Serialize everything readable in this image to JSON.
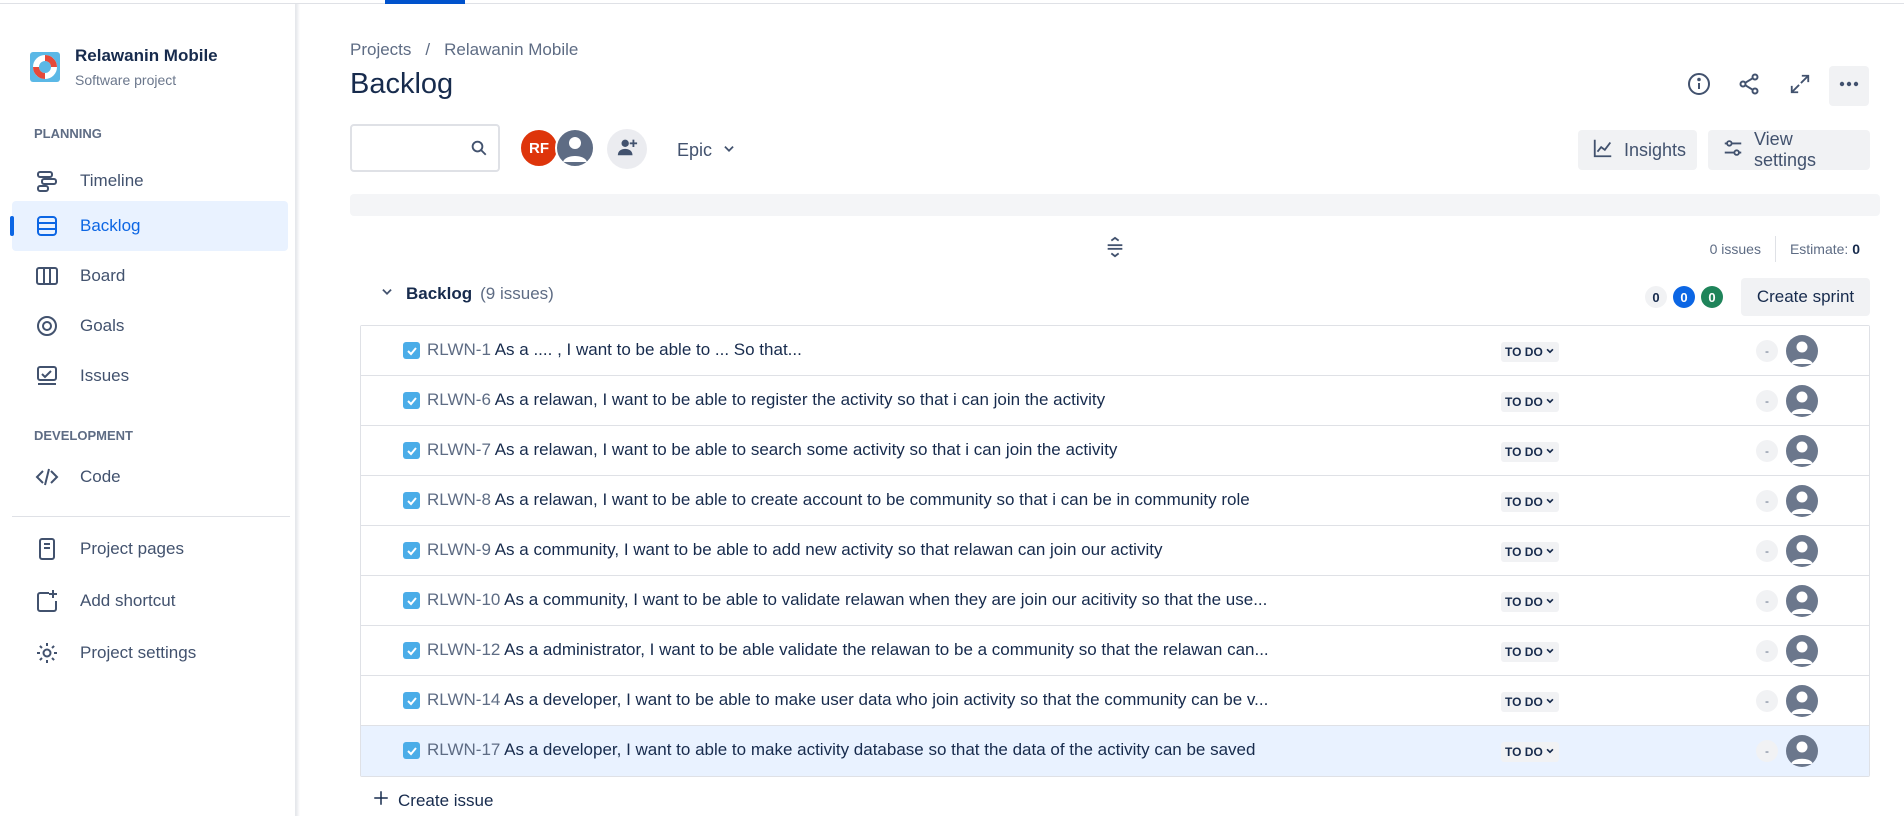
{
  "project": {
    "name": "Relawanin Mobile",
    "type": "Software project"
  },
  "sidebar": {
    "planning_title": "PLANNING",
    "development_title": "DEVELOPMENT",
    "planning": [
      {
        "label": "Timeline",
        "icon": "timeline-icon"
      },
      {
        "label": "Backlog",
        "icon": "backlog-icon",
        "active": true
      },
      {
        "label": "Board",
        "icon": "board-icon"
      },
      {
        "label": "Goals",
        "icon": "goals-icon"
      },
      {
        "label": "Issues",
        "icon": "issues-icon"
      }
    ],
    "development": [
      {
        "label": "Code",
        "icon": "code-icon"
      }
    ],
    "bottom": [
      {
        "label": "Project pages",
        "icon": "page-icon"
      },
      {
        "label": "Add shortcut",
        "icon": "add-shortcut-icon"
      },
      {
        "label": "Project settings",
        "icon": "gear-icon"
      }
    ]
  },
  "breadcrumb": {
    "root": "Projects",
    "sep": "/",
    "current": "Relawanin Mobile"
  },
  "page_title": "Backlog",
  "toolbar": {
    "search_placeholder": "",
    "avatar_initials": "RF",
    "epic_label": "Epic",
    "insights_label": "Insights",
    "view_settings_label": "View settings"
  },
  "stats": {
    "issues": "0 issues",
    "estimate_label": "Estimate:",
    "estimate_value": "0"
  },
  "backlog": {
    "title": "Backlog",
    "count": "(9 issues)",
    "pills": {
      "todo": "0",
      "in_progress": "0",
      "done": "0"
    },
    "create_sprint_label": "Create sprint",
    "create_issue_label": "Create issue",
    "issues": [
      {
        "key": "RLWN-1",
        "summary": "As a .... , I want to be able to ... So that...",
        "status": "TO DO",
        "estimate": "-"
      },
      {
        "key": "RLWN-6",
        "summary": "As a relawan, I want to be able to register the activity so that i can join the activity",
        "status": "TO DO",
        "estimate": "-"
      },
      {
        "key": "RLWN-7",
        "summary": "As a relawan, I want to be able to search some activity so that i can join the activity",
        "status": "TO DO",
        "estimate": "-"
      },
      {
        "key": "RLWN-8",
        "summary": "As a relawan, I want to be able to create account to be community so that i can be in community role",
        "status": "TO DO",
        "estimate": "-"
      },
      {
        "key": "RLWN-9",
        "summary": "As a community, I want to be able to add new activity so that relawan can join our activity",
        "status": "TO DO",
        "estimate": "-"
      },
      {
        "key": "RLWN-10",
        "summary": "As a community, I want to be able to validate relawan when they are join our acitivity so that the use...",
        "status": "TO DO",
        "estimate": "-"
      },
      {
        "key": "RLWN-12",
        "summary": "As a administrator, I want to be able validate the relawan to be a community so that the relawan can...",
        "status": "TO DO",
        "estimate": "-"
      },
      {
        "key": "RLWN-14",
        "summary": "As a developer, I want to be able to make user data who join activity so that the community can be v...",
        "status": "TO DO",
        "estimate": "-"
      },
      {
        "key": "RLWN-17",
        "summary": "As a developer, I want to able to make activity database so that the data of the activity can be saved",
        "status": "TO DO",
        "estimate": "-",
        "selected": true
      }
    ]
  },
  "colors": {
    "accent": "#0c66e4",
    "selected_row": "#e9f2ff",
    "checkbox": "#4bade8",
    "rf_avatar": "#de350b"
  }
}
